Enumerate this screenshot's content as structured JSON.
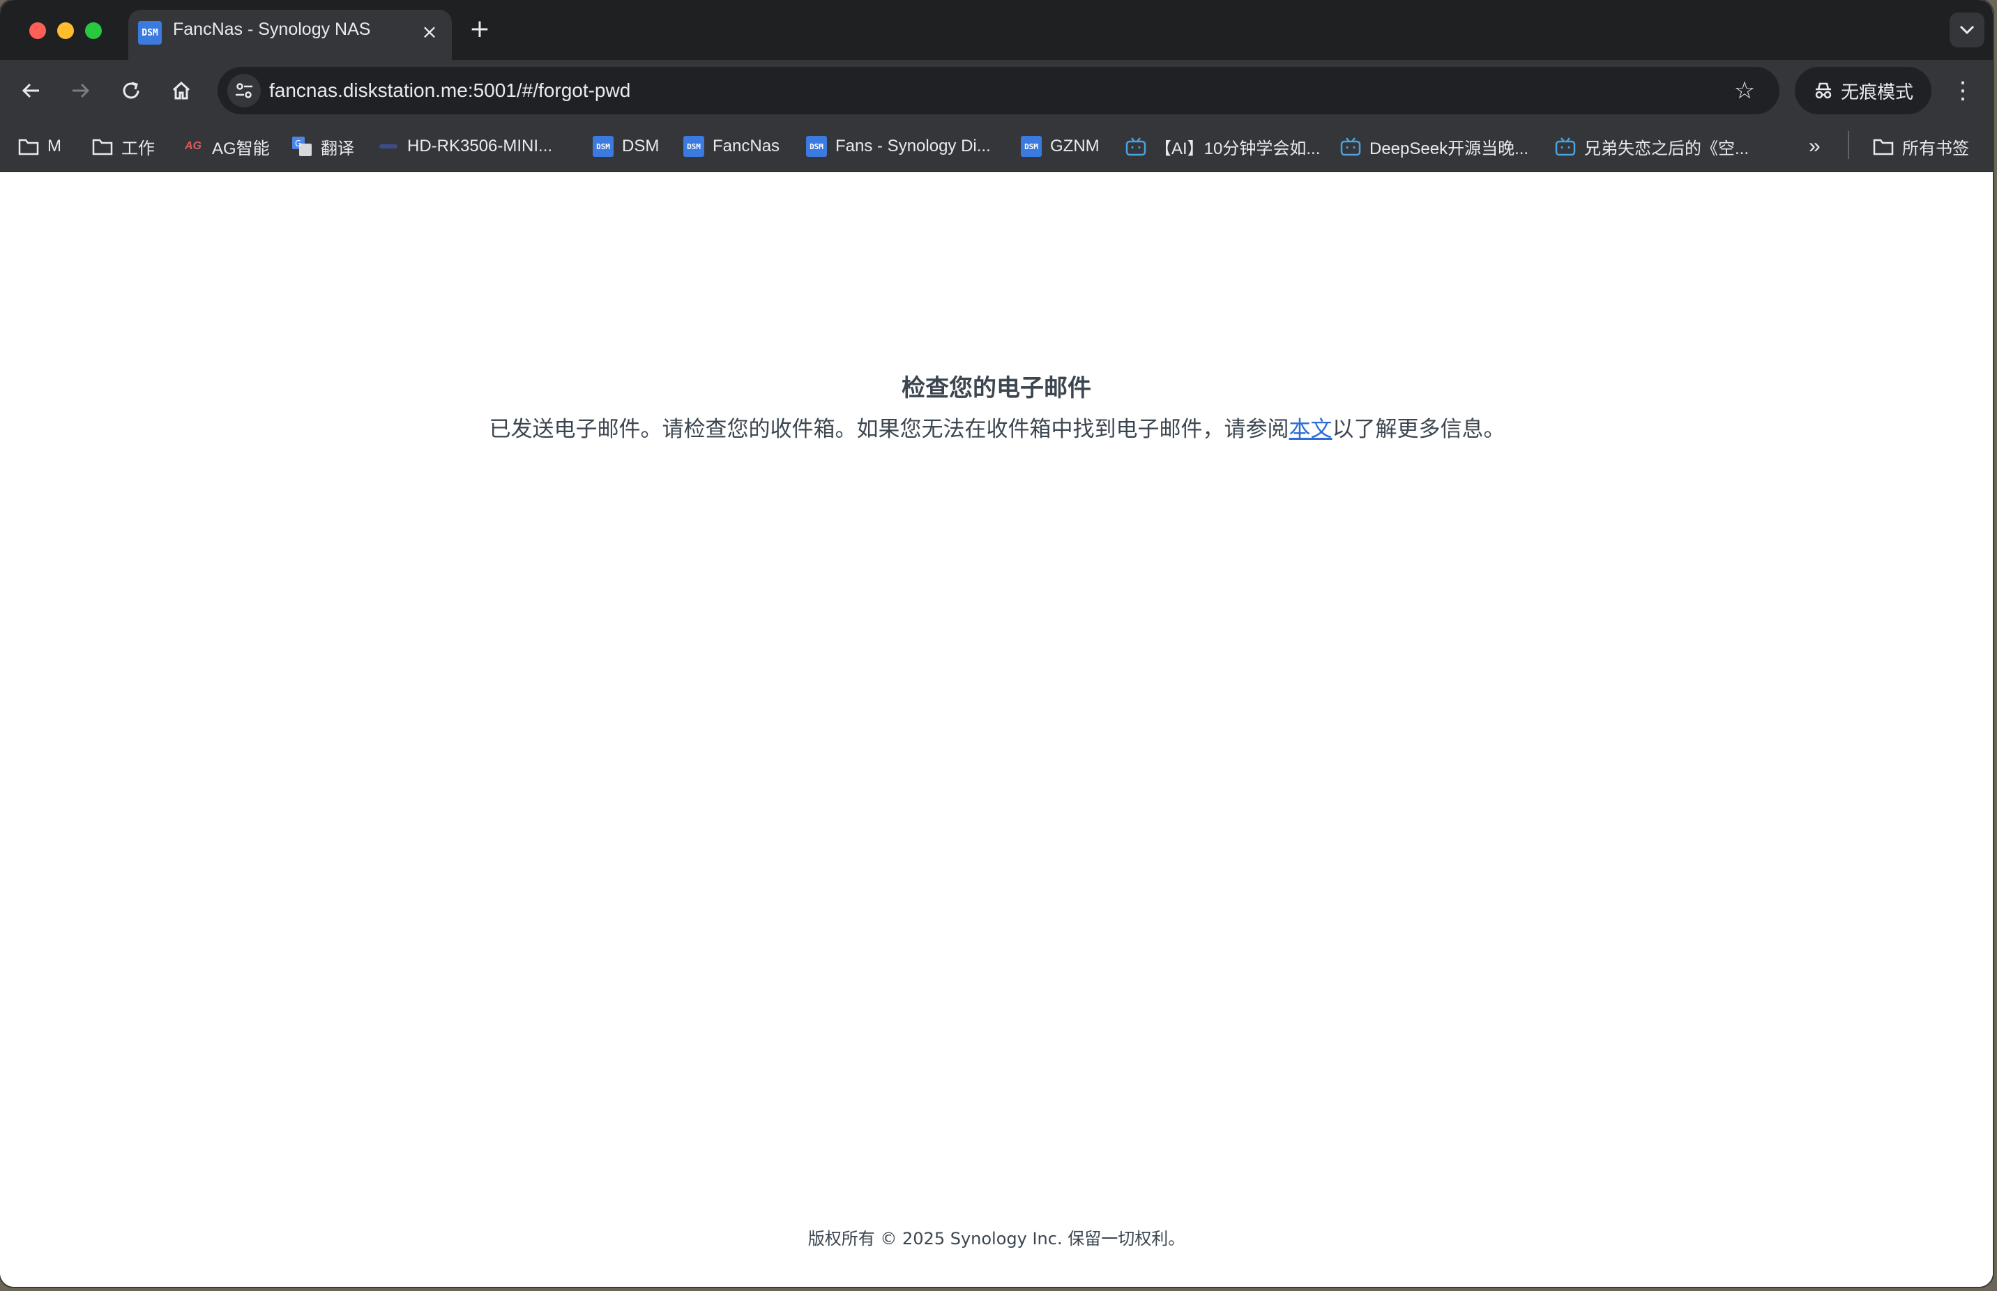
{
  "browser": {
    "tab": {
      "favicon_text": "DSM",
      "title": "FancNas - Synology NAS",
      "close_glyph": "×"
    },
    "new_tab_glyph": "+",
    "url": "fancnas.diskstation.me:5001/#/forgot-pwd",
    "incognito_label": "无痕模式",
    "bookmarks": [
      {
        "label": "M",
        "icon": "folder-icon"
      },
      {
        "label": "工作",
        "icon": "folder-icon"
      },
      {
        "label": "AG智能",
        "icon": "ag-logo-icon"
      },
      {
        "label": "翻译",
        "icon": "translate-icon"
      },
      {
        "label": "HD-RK3506-MINI...",
        "icon": "board-icon"
      },
      {
        "label": "DSM",
        "icon": "dsm-icon"
      },
      {
        "label": "FancNas",
        "icon": "dsm-icon"
      },
      {
        "label": "Fans - Synology Di...",
        "icon": "dsm-icon"
      },
      {
        "label": "GZNM",
        "icon": "dsm-icon"
      },
      {
        "label": "【AI】10分钟学会如...",
        "icon": "bilibili-icon"
      },
      {
        "label": "DeepSeek开源当晚...",
        "icon": "bilibili-icon"
      },
      {
        "label": "兄弟失恋之后的《空...",
        "icon": "bilibili-icon"
      }
    ],
    "overflow_glyph": "»",
    "all_bookmarks_label": "所有书签"
  },
  "page": {
    "heading": "检查您的电子邮件",
    "message_before": "已发送电子邮件。请检查您的收件箱。如果您无法在收件箱中找到电子邮件，请参阅",
    "message_link": "本文",
    "message_after": "以了解更多信息。",
    "copyright": "版权所有 © 2025 Synology Inc. 保留一切权利。"
  },
  "colors": {
    "browser_dark": "#35363a",
    "link": "#2a6fd1",
    "text": "#3c4650",
    "dsm_blue": "#3b7be0"
  }
}
